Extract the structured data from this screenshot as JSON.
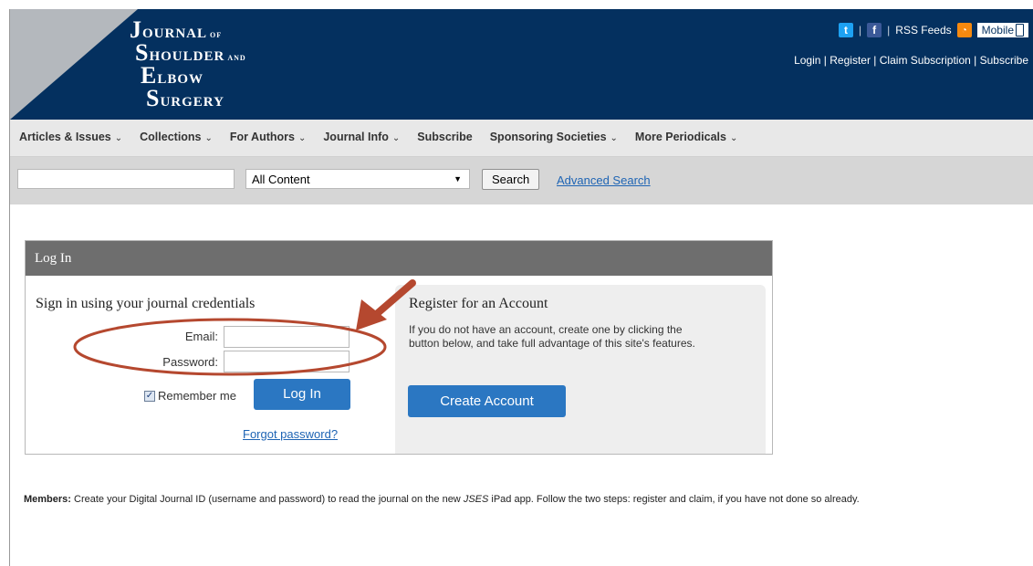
{
  "header": {
    "logo": {
      "line1": {
        "initial": "J",
        "rest": "OURNAL",
        "small": "OF"
      },
      "line2": {
        "initial": "S",
        "rest": "HOULDER",
        "small": "AND"
      },
      "line3": {
        "initial": "E",
        "rest": "LBOW"
      },
      "line4": {
        "initial": "S",
        "rest": "URGERY"
      }
    },
    "icons": {
      "twitter": "twitter-icon",
      "facebook": "facebook-icon",
      "rss": "rss-icon",
      "mobile": "mobile-phone-icon"
    },
    "rss_label": "RSS Feeds",
    "mobile_label": "Mobile",
    "links": {
      "login": "Login",
      "register": "Register",
      "claim": "Claim Subscription",
      "subscribe": "Subscribe"
    },
    "separator": "|"
  },
  "nav": {
    "items": [
      {
        "label": "Articles & Issues",
        "caret": "⌄"
      },
      {
        "label": "Collections",
        "caret": "⌄"
      },
      {
        "label": "For Authors",
        "caret": "⌄"
      },
      {
        "label": "Journal Info",
        "caret": "⌄"
      },
      {
        "label": "Subscribe",
        "caret": ""
      },
      {
        "label": "Sponsoring Societies",
        "caret": "⌄"
      },
      {
        "label": "More Periodicals",
        "caret": "⌄"
      }
    ]
  },
  "search": {
    "query": "",
    "scope": "All Content",
    "button": "Search",
    "advanced": "Advanced Search"
  },
  "login": {
    "title": "Log In",
    "sign_in_heading": "Sign in using your journal credentials",
    "email_label": "Email:",
    "password_label": "Password:",
    "email_value": "",
    "password_value": "",
    "remember_label": "Remember me",
    "remember_checked": true,
    "login_button": "Log In",
    "forgot": "Forgot password?"
  },
  "register": {
    "title": "Register for an Account",
    "line1": "If you do not have an account, create one by clicking the",
    "line2": "button below, and take full advantage of this site's features.",
    "button": "Create Account"
  },
  "members": {
    "label": "Members:",
    "text_before": " Create your Digital Journal ID (username and password) to read the journal on the new ",
    "italic": "JSES",
    "text_after": " iPad app. Follow the two steps: register and claim, if you have not done so already."
  },
  "colors": {
    "header": "#04305f",
    "button": "#2b77c2",
    "annotation": "#b5482f"
  }
}
